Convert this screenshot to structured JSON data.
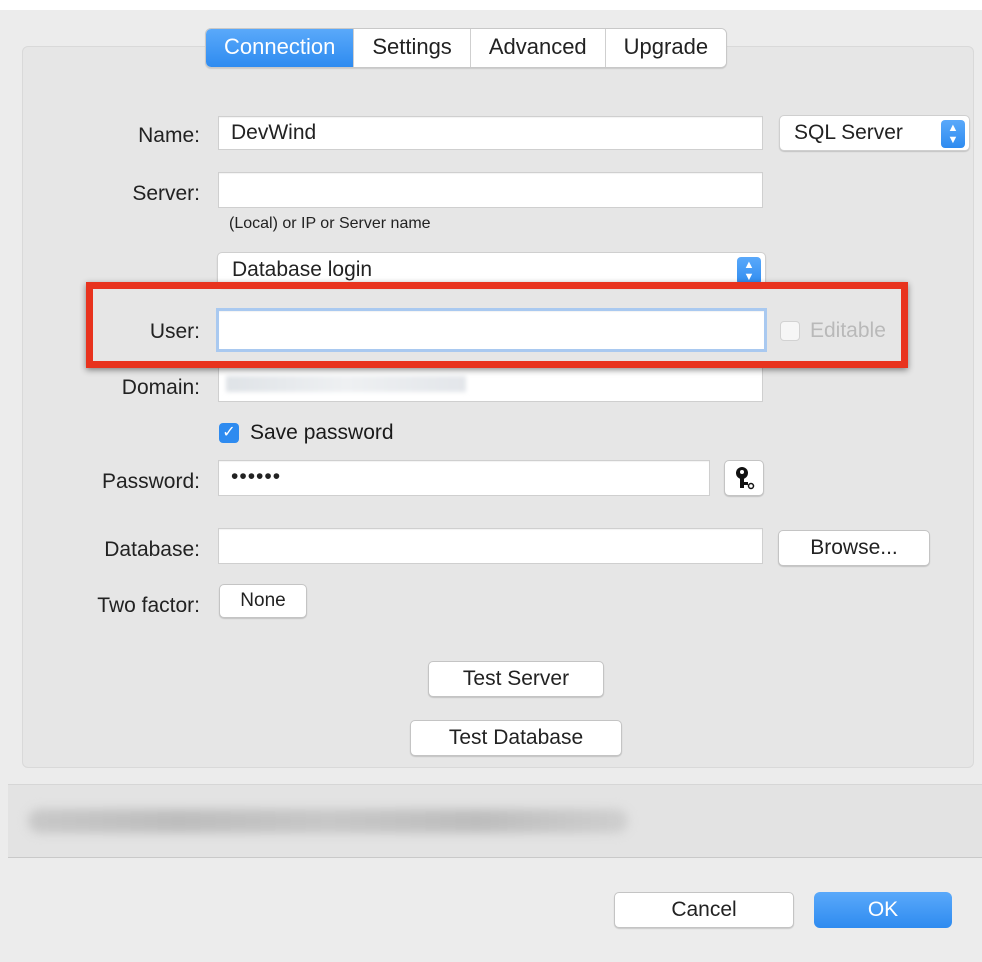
{
  "tabs": [
    "Connection",
    "Settings",
    "Advanced",
    "Upgrade"
  ],
  "form": {
    "name_label": "Name:",
    "name_value": "DevWind",
    "server_type": "SQL Server",
    "server_label": "Server:",
    "server_value": "",
    "server_hint": "(Local) or IP or Server name",
    "auth_method": "Database login",
    "user_label": "User:",
    "user_value": "",
    "editable_label": "Editable",
    "domain_label": "Domain:",
    "save_password_label": "Save password",
    "save_password_checked": true,
    "password_label": "Password:",
    "password_value": "••••••",
    "database_label": "Database:",
    "database_value": "",
    "browse_label": "Browse...",
    "two_factor_label": "Two factor:",
    "two_factor_value": "None",
    "test_server_label": "Test Server",
    "test_database_label": "Test Database"
  },
  "footer": {
    "cancel_label": "Cancel",
    "ok_label": "OK"
  },
  "icons": {
    "stepper": "chevron-up-down-icon",
    "key": "key-icon",
    "checkmark": "checkmark-icon"
  },
  "colors": {
    "accent": "#2e8bf0",
    "highlight": "#e8331e"
  }
}
